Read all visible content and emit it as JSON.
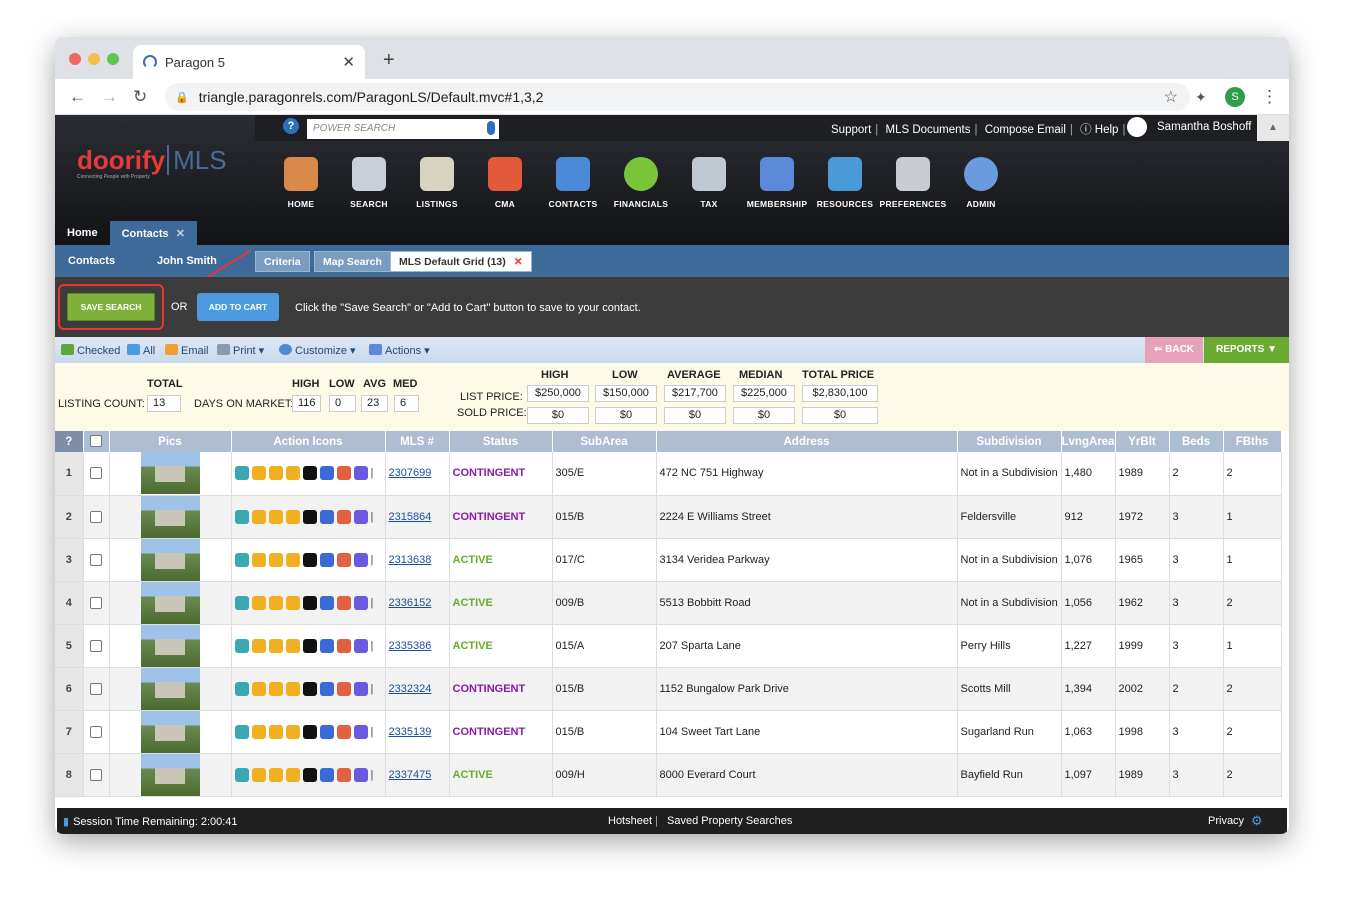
{
  "browser": {
    "tab_title": "Paragon 5",
    "url": "triangle.paragonrels.com/ParagonLS/Default.mvc#1,3,2",
    "profile_initial": "S"
  },
  "header": {
    "power_search_placeholder": "POWER SEARCH",
    "links": [
      "Support",
      "MLS Documents",
      "Compose Email",
      "Help"
    ],
    "user_name": "Samantha Boshoff",
    "logo_main": "doorify",
    "logo_mls": "MLS",
    "logo_tagline": "Connecting People with Property"
  },
  "nav_icons": [
    {
      "label": "HOME",
      "color": "#d9894a"
    },
    {
      "label": "SEARCH",
      "color": "#c9cfd8"
    },
    {
      "label": "LISTINGS",
      "color": "#d8d2c0"
    },
    {
      "label": "CMA",
      "color": "#e35a3a"
    },
    {
      "label": "CONTACTS",
      "color": "#4a8ad6"
    },
    {
      "label": "FINANCIALS",
      "color": "#7ac43a"
    },
    {
      "label": "TAX",
      "color": "#c0c8d2"
    },
    {
      "label": "MEMBERSHIP",
      "color": "#5a8ad8"
    },
    {
      "label": "RESOURCES",
      "color": "#4a9ad8"
    },
    {
      "label": "PREFERENCES",
      "color": "#c8ccd2"
    },
    {
      "label": "ADMIN",
      "color": "#6a9ae0"
    }
  ],
  "app_tabs": [
    "Home",
    "Contacts"
  ],
  "subnav": {
    "contacts": "Contacts",
    "contact_name": "John Smith",
    "tabs": [
      "Criteria",
      "Map Search",
      "MLS Default Grid (13)"
    ]
  },
  "actionbar": {
    "save_search": "SAVE SEARCH",
    "or": "OR",
    "add_to_cart": "ADD TO CART",
    "instruction": "Click the \"Save Search\" or \"Add to Cart\" button to save to your contact."
  },
  "toolbar": {
    "checked": "Checked",
    "all": "All",
    "email": "Email",
    "print": "Print",
    "customize": "Customize",
    "actions": "Actions",
    "back": "BACK",
    "reports": "REPORTS"
  },
  "stats": {
    "total_label": "TOTAL",
    "listing_count_label": "LISTING COUNT:",
    "listing_count": "13",
    "dom_label": "DAYS ON MARKET:",
    "dom_headers": [
      "HIGH",
      "LOW",
      "AVG",
      "MED"
    ],
    "dom_values": [
      "116",
      "0",
      "23",
      "6"
    ],
    "price_headers": [
      "HIGH",
      "LOW",
      "AVERAGE",
      "MEDIAN",
      "TOTAL PRICE"
    ],
    "list_price_label": "LIST PRICE:",
    "list_prices": [
      "$250,000",
      "$150,000",
      "$217,700",
      "$225,000",
      "$2,830,100"
    ],
    "sold_price_label": "SOLD PRICE:",
    "sold_prices": [
      "$0",
      "$0",
      "$0",
      "$0",
      "$0"
    ]
  },
  "table": {
    "headers": [
      "?",
      "",
      "Pics",
      "Action Icons",
      "MLS #",
      "Status",
      "SubArea",
      "Address",
      "Subdivision",
      "LvngArea",
      "YrBlt",
      "Beds",
      "FBths"
    ],
    "rows": [
      {
        "n": "1",
        "mls": "2307699",
        "status": "CONTINGENT",
        "sub": "305/E",
        "addr": "472 NC 751 Highway",
        "subdiv": "Not in a Subdivision",
        "area": "1,480",
        "yr": "1989",
        "beds": "2",
        "fb": "2"
      },
      {
        "n": "2",
        "mls": "2315864",
        "status": "CONTINGENT",
        "sub": "015/B",
        "addr": "2224 E Williams Street",
        "subdiv": "Feldersville",
        "area": "912",
        "yr": "1972",
        "beds": "3",
        "fb": "1"
      },
      {
        "n": "3",
        "mls": "2313638",
        "status": "ACTIVE",
        "sub": "017/C",
        "addr": "3134 Veridea Parkway",
        "subdiv": "Not in a Subdivision",
        "area": "1,076",
        "yr": "1965",
        "beds": "3",
        "fb": "1"
      },
      {
        "n": "4",
        "mls": "2336152",
        "status": "ACTIVE",
        "sub": "009/B",
        "addr": "5513 Bobbitt Road",
        "subdiv": "Not in a Subdivision",
        "area": "1,056",
        "yr": "1962",
        "beds": "3",
        "fb": "2"
      },
      {
        "n": "5",
        "mls": "2335386",
        "status": "ACTIVE",
        "sub": "015/A",
        "addr": "207 Sparta Lane",
        "subdiv": "Perry Hills",
        "area": "1,227",
        "yr": "1999",
        "beds": "3",
        "fb": "1"
      },
      {
        "n": "6",
        "mls": "2332324",
        "status": "CONTINGENT",
        "sub": "015/B",
        "addr": "1152 Bungalow Park Drive",
        "subdiv": "Scotts Mill",
        "area": "1,394",
        "yr": "2002",
        "beds": "2",
        "fb": "2"
      },
      {
        "n": "7",
        "mls": "2335139",
        "status": "CONTINGENT",
        "sub": "015/B",
        "addr": "104 Sweet Tart Lane",
        "subdiv": "Sugarland Run",
        "area": "1,063",
        "yr": "1998",
        "beds": "3",
        "fb": "2"
      },
      {
        "n": "8",
        "mls": "2337475",
        "status": "ACTIVE",
        "sub": "009/H",
        "addr": "8000 Everard Court",
        "subdiv": "Bayfield Run",
        "area": "1,097",
        "yr": "1989",
        "beds": "3",
        "fb": "2"
      }
    ]
  },
  "footer": {
    "session": "Session Time Remaining: 2:00:41",
    "hotsheet": "Hotsheet",
    "saved": "Saved Property Searches",
    "privacy": "Privacy"
  }
}
